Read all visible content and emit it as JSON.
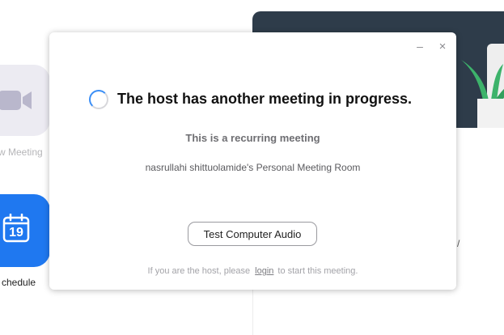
{
  "background": {
    "video_tile_label": "w Meeting",
    "schedule_tile_label": "chedule",
    "calendar_day": "19",
    "stray_text": "/"
  },
  "dialog": {
    "minimize_glyph": "–",
    "close_glyph": "×",
    "title": "The host has another meeting in progress.",
    "subtitle": "This is a recurring meeting",
    "room_name": "nasrullahi shittuolamide's Personal Meeting Room",
    "test_audio_label": "Test Computer Audio",
    "footer_prefix": "If you are the host, please",
    "footer_link": "login",
    "footer_suffix": "to start this meeting."
  },
  "colors": {
    "accent_blue": "#1f78f0",
    "spinner_blue": "#3a8ef6",
    "banner_dark": "#2e3c4a",
    "plant_green": "#3db36b"
  }
}
